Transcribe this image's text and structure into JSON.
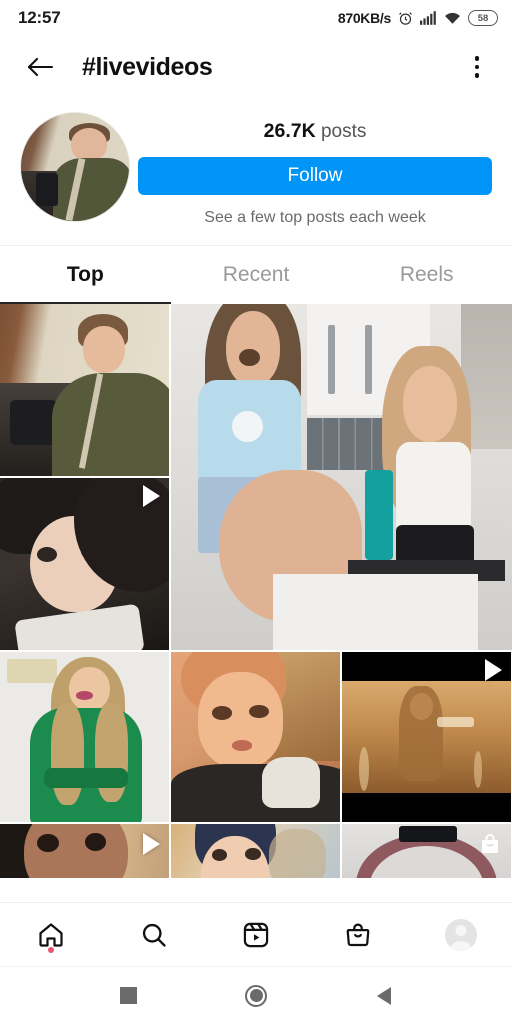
{
  "statusbar": {
    "time": "12:57",
    "network_speed": "870KB/s",
    "alarm_icon": "alarm-clock-icon",
    "signal_icon": "cellular-signal-icon",
    "wifi_icon": "wifi-icon",
    "battery_level": "58"
  },
  "header": {
    "back_icon": "back-arrow-icon",
    "title": "#livevideos",
    "menu_icon": "overflow-menu-icon"
  },
  "profile": {
    "avatar_name": "hashtag-avatar",
    "posts_count": "26.7K",
    "posts_label": "posts",
    "follow_label": "Follow",
    "subtitle": "See a few top posts each week",
    "follow_color": "#0095f6"
  },
  "tabs": [
    {
      "label": "Top",
      "active": true
    },
    {
      "label": "Recent",
      "active": false
    },
    {
      "label": "Reels",
      "active": false
    }
  ],
  "grid": {
    "tiles": [
      {
        "id": "tile-1",
        "kind": "photo",
        "badge": "none"
      },
      {
        "id": "tile-2",
        "kind": "video",
        "badge": "play"
      },
      {
        "id": "tile-3",
        "kind": "photo",
        "badge": "none"
      },
      {
        "id": "tile-4",
        "kind": "photo",
        "badge": "none"
      },
      {
        "id": "tile-5",
        "kind": "photo",
        "badge": "none"
      },
      {
        "id": "tile-6",
        "kind": "video",
        "badge": "play"
      },
      {
        "id": "tile-7",
        "kind": "video",
        "badge": "play"
      },
      {
        "id": "tile-8",
        "kind": "photo",
        "badge": "none"
      },
      {
        "id": "tile-9",
        "kind": "shopping",
        "badge": "shop"
      }
    ]
  },
  "bottomnav": [
    {
      "name": "home",
      "icon": "home-icon",
      "badge_dot": true
    },
    {
      "name": "search",
      "icon": "search-icon",
      "badge_dot": false
    },
    {
      "name": "reels",
      "icon": "reels-icon",
      "badge_dot": false
    },
    {
      "name": "shop",
      "icon": "shopping-bag-icon",
      "badge_dot": false
    },
    {
      "name": "profile",
      "icon": "profile-avatar-icon",
      "badge_dot": false
    }
  ],
  "androidnav": [
    {
      "name": "recents",
      "icon": "square-icon"
    },
    {
      "name": "home",
      "icon": "circle-icon"
    },
    {
      "name": "back",
      "icon": "triangle-back-icon"
    }
  ]
}
